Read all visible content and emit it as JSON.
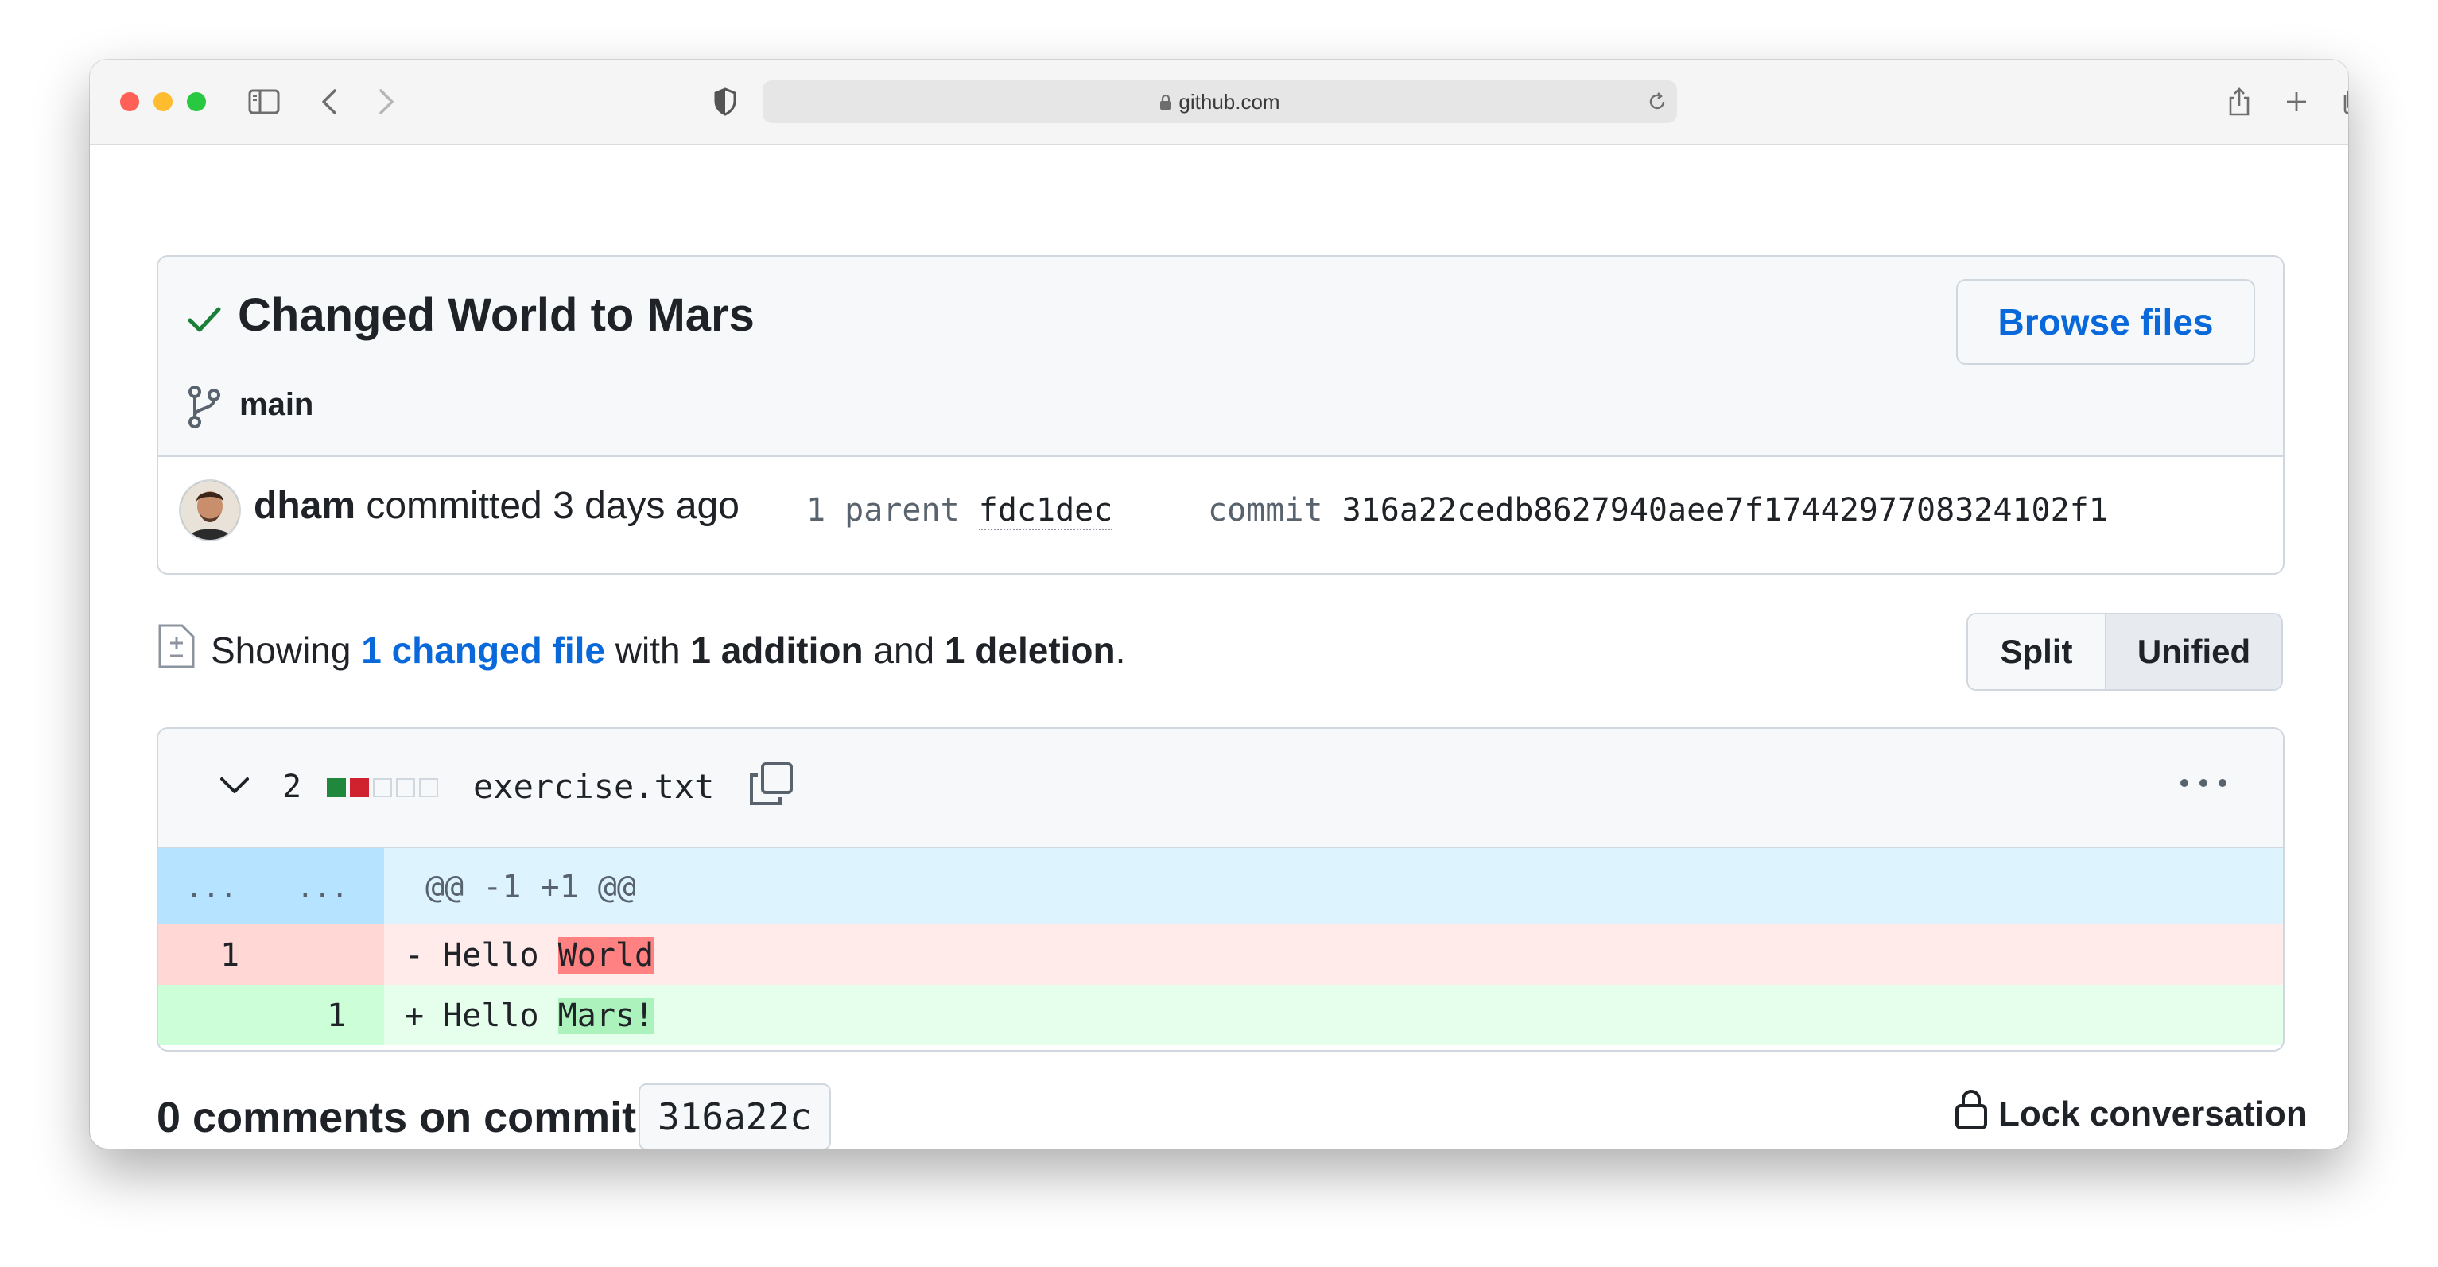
{
  "browser": {
    "url": "github.com"
  },
  "commit": {
    "title": "Changed World to Mars",
    "branch": "main",
    "browse_label": "Browse files",
    "author": "dham",
    "committed_text": "committed 3 days ago",
    "parent_label": "1 parent",
    "parent_sha": "fdc1dec",
    "commit_label": "commit",
    "commit_sha": "316a22cedb8627940aee7f1744297708324102f1"
  },
  "summary": {
    "showing": "Showing",
    "changed": "1 changed file",
    "with": "with",
    "additions": "1 addition",
    "and": "and",
    "deletions": "1 deletion",
    "period": "."
  },
  "view_toggle": {
    "split": "Split",
    "unified": "Unified",
    "selected": "Unified"
  },
  "file": {
    "change_count": "2",
    "name": "exercise.txt",
    "diffstat": [
      "added",
      "deleted",
      "neutral",
      "neutral",
      "neutral"
    ],
    "hunk_old": "...",
    "hunk_new": "...",
    "hunk_header": "@@ -1 +1 @@",
    "lines": [
      {
        "type": "deletion",
        "old": "1",
        "new": "",
        "sign": "-",
        "prefix": " Hello ",
        "highlight": "World"
      },
      {
        "type": "addition",
        "old": "",
        "new": "1",
        "sign": "+",
        "prefix": " Hello ",
        "highlight": "Mars!"
      }
    ]
  },
  "comments": {
    "title": "0 comments on commit",
    "sha": "316a22c",
    "lock_label": "Lock conversation"
  },
  "colors": {
    "link": "#0969da",
    "success": "#1a7f37",
    "deletion_bg": "#ffebe9",
    "addition_bg": "#e6ffec",
    "hunk_bg": "#ddf4ff"
  }
}
